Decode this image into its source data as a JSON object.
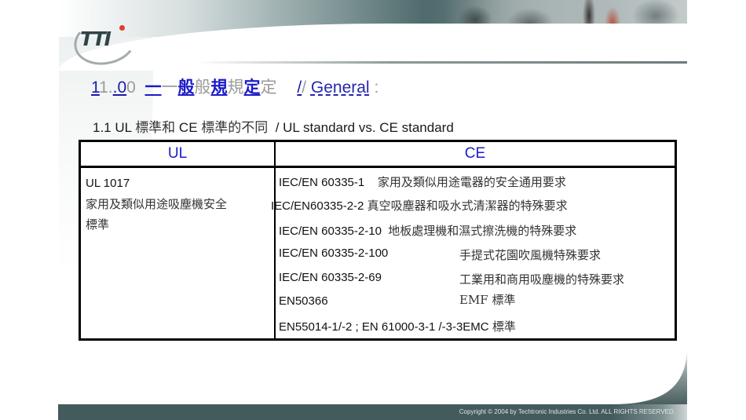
{
  "logo": {
    "text": "TTI"
  },
  "title": {
    "number": "1",
    "number_ghost": "1.",
    "number2": ".0",
    "number2_ghost": "0",
    "chars": [
      {
        "main": "一",
        "ghost": "一"
      },
      {
        "main": "般",
        "ghost": "般"
      },
      {
        "main": "規",
        "ghost": "規"
      },
      {
        "main": "定",
        "ghost": "定"
      }
    ],
    "separator": "/",
    "separator_ghost": "/",
    "english": "General",
    "english_ghost": "General",
    "colon": ":"
  },
  "subtitle": {
    "number": "1.1 UL ",
    "zh1": "標準和",
    "mid": " CE ",
    "zh2": "標準的不同",
    "english": "  / UL standard vs. CE standard"
  },
  "table": {
    "headers": {
      "ul": "UL",
      "ce": "CE"
    },
    "ul_cell": {
      "code": "UL 1017",
      "desc_line1": "家用及類似用途吸塵機安全",
      "desc_line2": "標準"
    },
    "ce_rows": [
      {
        "code": "IEC/EN 60335-1",
        "desc": "家用及類似用途電器的安全通用要求"
      },
      {
        "code": "IEC/EN60335-2-2",
        "desc": "真空吸塵器和吸水式清潔器的特殊要求"
      },
      {
        "code": "IEC/EN 60335-2-10",
        "desc": "地板處理機和濕式擦洗機的特殊要求"
      },
      {
        "code": "IEC/EN 60335-2-100",
        "desc": "手提式花園吹風機特殊要求"
      },
      {
        "code": "IEC/EN 60335-2-69",
        "desc": "工業用和商用吸塵機的特殊要求"
      },
      {
        "code": "EN50366",
        "desc": "EMF 標準"
      },
      {
        "code": "EN55014-1/-2 ; EN 61000-3-1 /-3-3EMC",
        "desc": "標準"
      }
    ]
  },
  "footer": {
    "copyright": "Copyright © 2004 by Techtronic Industries Co. Ltd. ALL RIGHTS RESERVED."
  },
  "colors": {
    "title_blue": "#1a1ac8",
    "header_teal": "#435b5d",
    "logo_red": "#e0402a"
  }
}
